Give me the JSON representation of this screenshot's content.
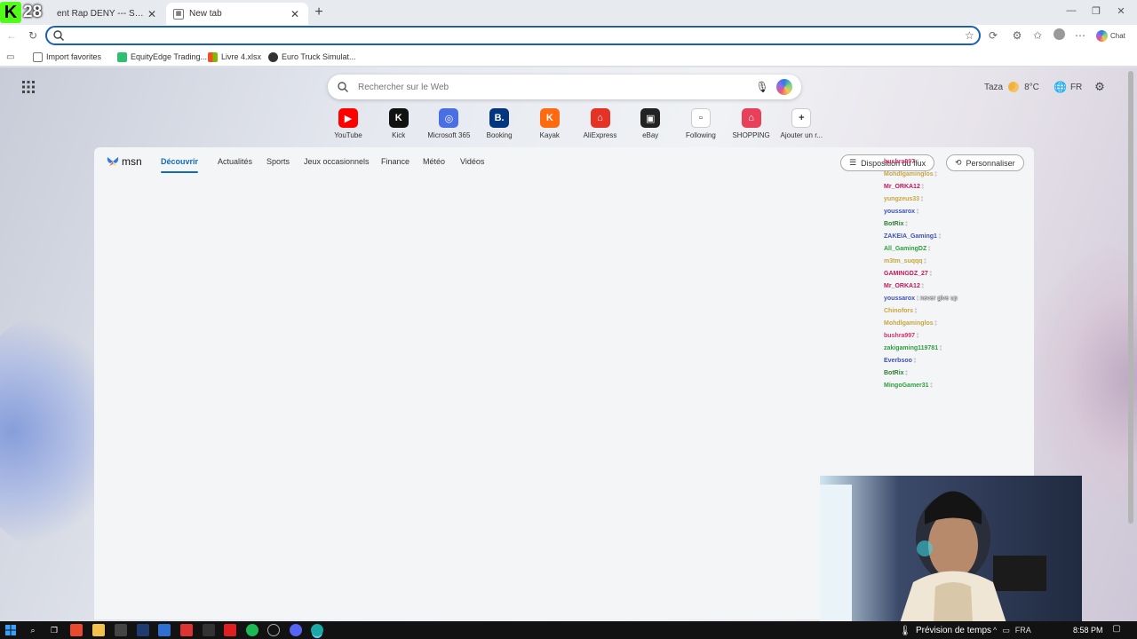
{
  "stream_overlay": {
    "viewer_badge": "28"
  },
  "browser": {
    "tabs": [
      {
        "title": "ent Rap DENY --- Streamers rea",
        "active": false
      },
      {
        "title": "New tab",
        "active": true
      }
    ],
    "address_value": "",
    "profile_label": "Chat",
    "favorites": [
      {
        "label": "Import favorites"
      },
      {
        "label": "EquityEdge Trading..."
      },
      {
        "label": "Livre 4.xlsx"
      },
      {
        "label": "Euro Truck Simulat..."
      }
    ]
  },
  "newtab": {
    "search_placeholder": "Rechercher sur le Web",
    "weather": {
      "city": "Taza",
      "temp": "8°C"
    },
    "language": "FR",
    "quick_links": [
      {
        "label": "YouTube",
        "icon": "youtube-icon",
        "glyph": "▶",
        "color": "#ff0000"
      },
      {
        "label": "Kick",
        "icon": "kick-icon",
        "glyph": "K",
        "color": "#111111"
      },
      {
        "label": "Microsoft 365",
        "icon": "microsoft-365-icon",
        "glyph": "◎",
        "color": "#4a6fe3"
      },
      {
        "label": "Booking",
        "icon": "booking-icon",
        "glyph": "B.",
        "color": "#003580"
      },
      {
        "label": "Kayak",
        "icon": "kayak-icon",
        "glyph": "K",
        "color": "#ff690f"
      },
      {
        "label": "AliExpress",
        "icon": "aliexpress-icon",
        "glyph": "⌂",
        "color": "#e43225"
      },
      {
        "label": "eBay",
        "icon": "ebay-icon",
        "glyph": "▣",
        "color": "#222222"
      },
      {
        "label": "Following",
        "icon": "following-icon",
        "glyph": "▫",
        "color": "#ffffff"
      },
      {
        "label": "SHOPPING",
        "icon": "shopping-icon",
        "glyph": "⌂",
        "color": "#e8405a"
      },
      {
        "label": "Ajouter un r...",
        "icon": "add-icon",
        "glyph": "+",
        "color": "#ffffff"
      }
    ]
  },
  "msn": {
    "logo": "msn",
    "tabs": [
      "Découvrir",
      "Actualités",
      "Sports",
      "Jeux occasionnels",
      "Finance",
      "Météo",
      "Vidéos"
    ],
    "layout_button": "Disposition du flux",
    "personalize_button": "Personnaliser"
  },
  "chat": [
    {
      "user": "bushra997",
      "color": "#d6336c",
      "text": ""
    },
    {
      "user": "Mohdlgaminglos",
      "color": "#c7a640",
      "text": ""
    },
    {
      "user": "Mr_ORKA12",
      "color": "#c2185b",
      "text": ""
    },
    {
      "user": "yungzeus33",
      "color": "#c7a640",
      "text": ""
    },
    {
      "user": "youssarox",
      "color": "#3f51b5",
      "text": ""
    },
    {
      "user": "BotRix",
      "color": "#2e7d32",
      "text": ""
    },
    {
      "user": "ZAKEIA_Gaming1",
      "color": "#3f51b5",
      "text": ""
    },
    {
      "user": "All_GamingDZ",
      "color": "#2e9e3e",
      "text": ""
    },
    {
      "user": "m3tm_suqqq",
      "color": "#c7a640",
      "text": ""
    },
    {
      "user": "GAMINGDZ_27",
      "color": "#c2185b",
      "text": ""
    },
    {
      "user": "Mr_ORKA12",
      "color": "#c2185b",
      "text": ""
    },
    {
      "user": "youssarox",
      "color": "#3f51b5",
      "text": "never give up"
    },
    {
      "user": "Chinofors",
      "color": "#c7a640",
      "text": ""
    },
    {
      "user": "Mohdlgaminglos",
      "color": "#c7a640",
      "text": ""
    },
    {
      "user": "bushra997",
      "color": "#d6336c",
      "text": ""
    },
    {
      "user": "zakigaming119781",
      "color": "#2e9e3e",
      "text": ""
    },
    {
      "user": "Everbsoo",
      "color": "#3f51b5",
      "text": ""
    },
    {
      "user": "BotRix",
      "color": "#2e7d32",
      "text": ""
    },
    {
      "user": "MingoGamer31",
      "color": "#2e9e3e",
      "text": ""
    }
  ],
  "taskbar": {
    "weather_label": "Prévision de temps",
    "language": "FRA",
    "time": "8:58 PM"
  }
}
